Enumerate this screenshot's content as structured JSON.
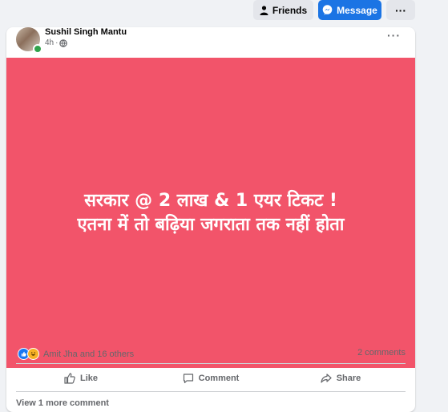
{
  "profile_actions": {
    "friends_label": "Friends",
    "message_label": "Message",
    "more_label": "···"
  },
  "post": {
    "author": "Sushil Singh Mantu",
    "time": "4h",
    "privacy_icon": "globe-icon",
    "more_label": "···",
    "text_lines": [
      "सरकार @ 2 लाख & 1 एयर टिकट !",
      "एतना में तो बढ़िया जगराता तक नहीं होता"
    ],
    "background_color": "#f2546a"
  },
  "stats": {
    "reactions_text": "Amit Jha and 16 others",
    "comments_text": "2 comments"
  },
  "actions": {
    "like_label": "Like",
    "comment_label": "Comment",
    "share_label": "Share"
  },
  "view_more": "View 1 more comment",
  "colors": {
    "accent": "#1b74e4",
    "card": "#ffffff",
    "page": "#f0f2f5"
  }
}
